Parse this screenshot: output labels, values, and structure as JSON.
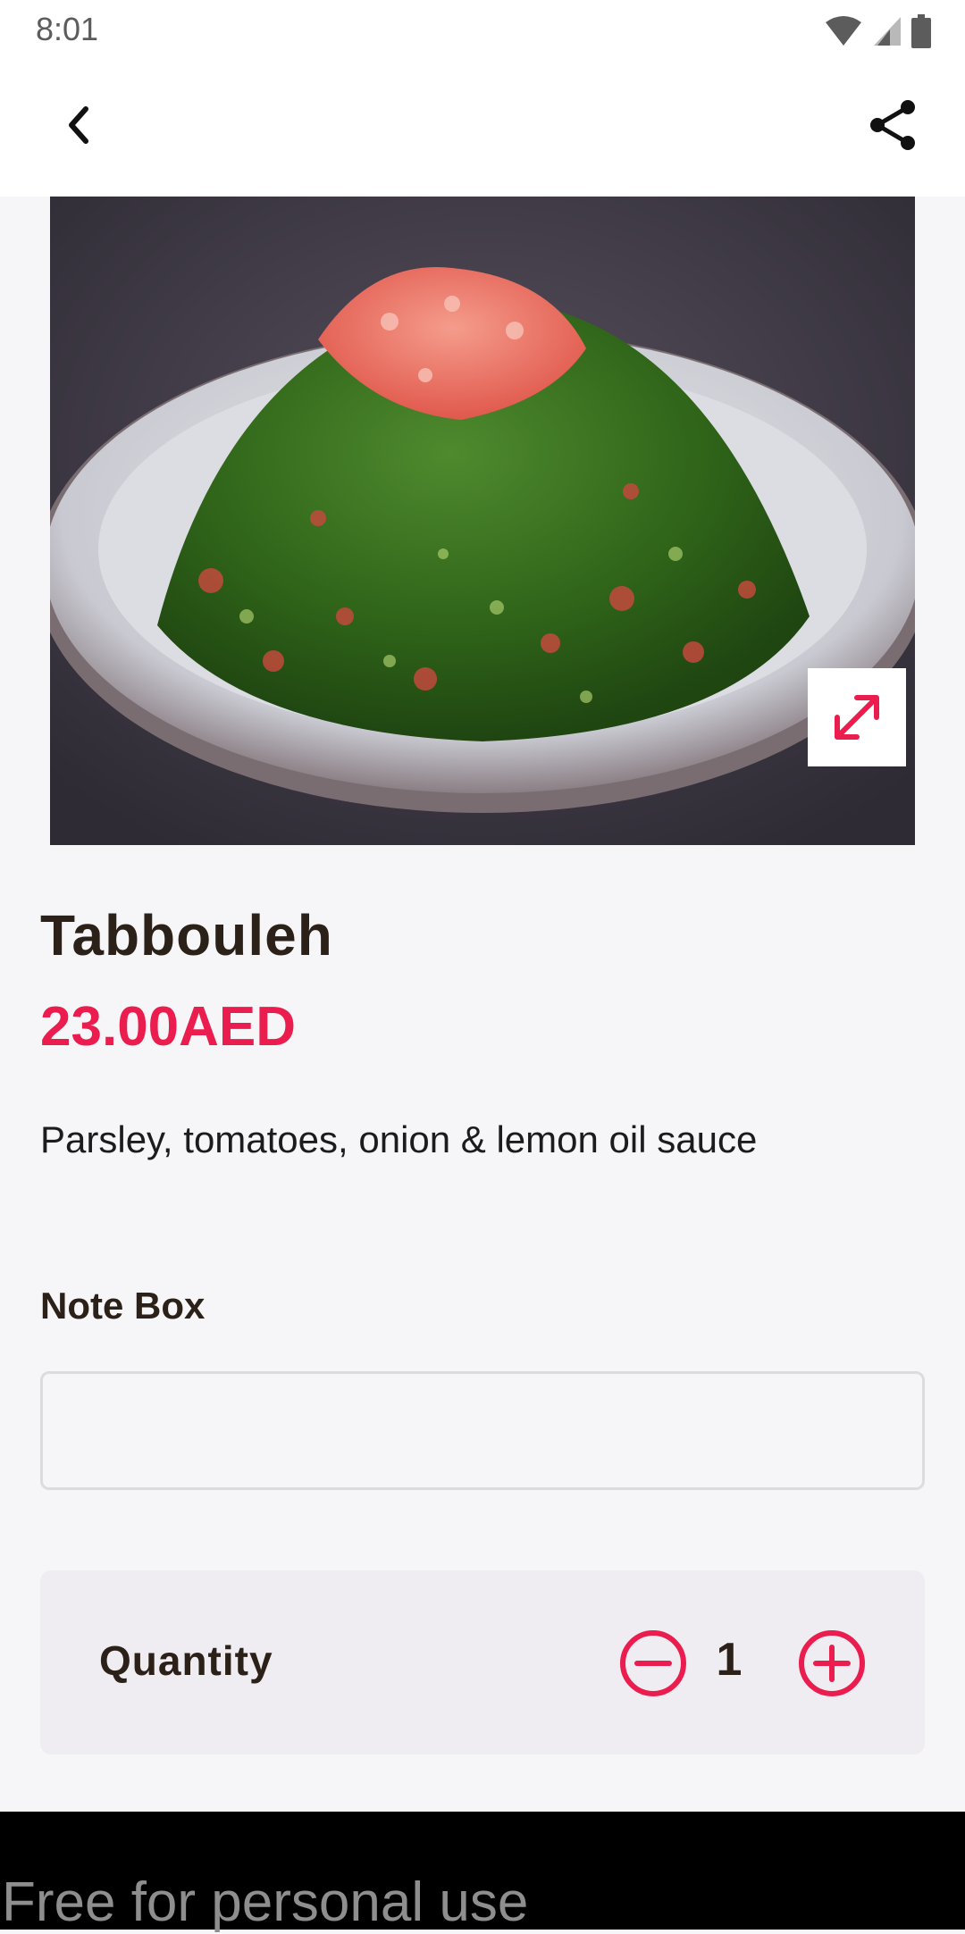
{
  "status": {
    "time": "8:01"
  },
  "product": {
    "title": "Tabbouleh",
    "price": "23.00AED",
    "description": "Parsley, tomatoes, onion & lemon oil sauce"
  },
  "note": {
    "label": "Note Box",
    "value": "",
    "placeholder": ""
  },
  "quantity": {
    "label": "Quantity",
    "value": "1"
  },
  "watermark": "Free for personal use",
  "colors": {
    "accent": "#ea1d4e",
    "text": "#2b2118",
    "background": "#f6f5f7"
  },
  "icons": {
    "back": "back-arrow-icon",
    "share": "share-icon",
    "expand": "expand-icon",
    "minus": "minus-circle-icon",
    "plus": "plus-circle-icon"
  }
}
